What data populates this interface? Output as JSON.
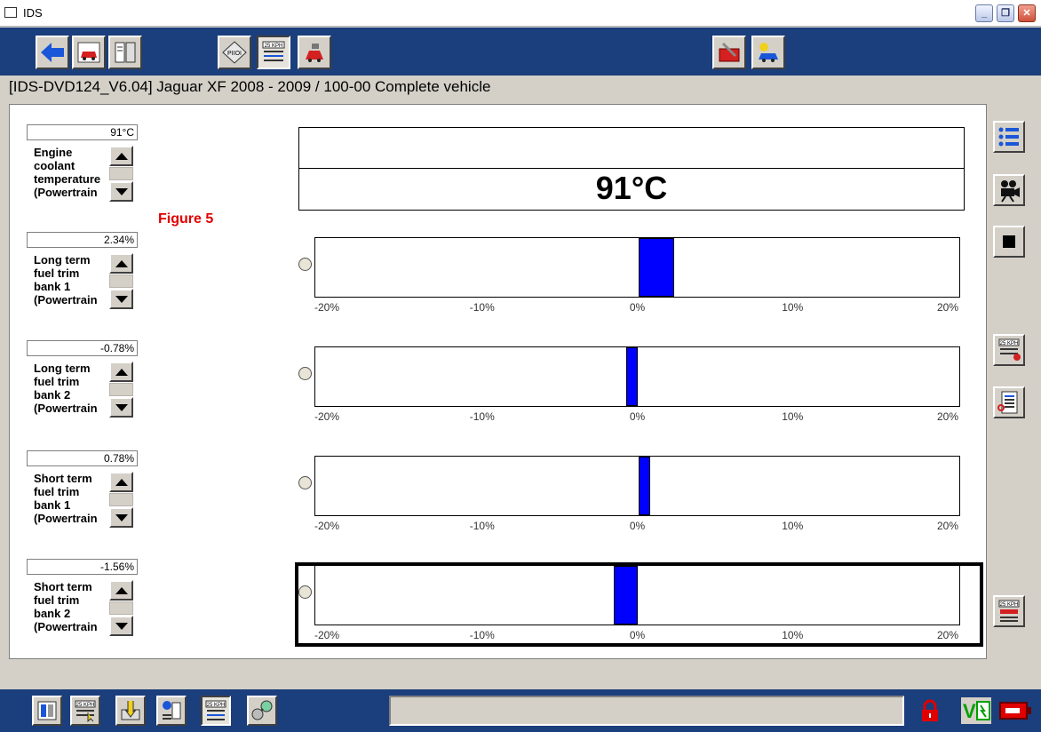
{
  "window": {
    "title": "IDS",
    "minimize_icon": "minimize-icon",
    "restore_icon": "restore-icon",
    "close_icon": "close-icon"
  },
  "toolbar": {
    "buttons": [
      {
        "name": "back-button",
        "icon": "back-arrow-icon"
      },
      {
        "name": "vehicle-session-button",
        "icon": "car-session-icon"
      },
      {
        "name": "toolbox-button",
        "icon": "toolbox-icon"
      },
      {
        "name": "pinpoint-test-button",
        "icon": "pinpoint-icon",
        "label": "PIIOI"
      },
      {
        "name": "datalogger-button",
        "icon": "datalogger-icon",
        "label": "25 KPH"
      },
      {
        "name": "workshop-tools-button",
        "icon": "workshop-tools-icon"
      },
      {
        "name": "settings-button",
        "icon": "tools-case-icon"
      },
      {
        "name": "vehicle-config-button",
        "icon": "vehicle-config-icon"
      }
    ]
  },
  "breadcrumb": "[IDS-DVD124_V6.04]  Jaguar XF 2008 - 2009 / 100-00 Complete vehicle",
  "figure_label": "Figure 5",
  "digital_display": {
    "value": "91°C"
  },
  "parameters": [
    {
      "value": "91°C",
      "name": "Engine\ncoolant\ntemperature\n(Powertrain"
    },
    {
      "value": "2.34%",
      "name": "Long term\nfuel trim\nbank 1\n(Powertrain"
    },
    {
      "value": "-0.78%",
      "name": "Long term\nfuel trim\nbank 2\n(Powertrain"
    },
    {
      "value": "0.78%",
      "name": "Short term\nfuel trim\nbank 1\n(Powertrain"
    },
    {
      "value": "-1.56%",
      "name": "Short term\nfuel trim\nbank 2\n(Powertrain"
    }
  ],
  "gauges": {
    "min": -20,
    "max": 20,
    "unit": "%",
    "ticks": [
      "-20%",
      "-10%",
      "0%",
      "10%",
      "20%"
    ],
    "bar_color": "#0000ff",
    "values": [
      2.34,
      -0.78,
      0.78,
      -1.56
    ],
    "selected_index": 3
  },
  "right_tools": [
    {
      "name": "parameter-list-button",
      "icon": "list-icon"
    },
    {
      "name": "record-button",
      "icon": "video-camera-icon"
    },
    {
      "name": "stop-button",
      "icon": "stop-icon"
    },
    {
      "name": "datalogger-recorded-button",
      "icon": "datalogger-record-icon",
      "label": "25 KPH"
    },
    {
      "name": "datalogger-list-button",
      "icon": "document-list-icon"
    },
    {
      "name": "datalogger-playback-button",
      "icon": "datalogger-playback-icon",
      "label": "25 KPH"
    }
  ],
  "bottom_tools": [
    {
      "name": "modules-button",
      "icon": "modules-icon"
    },
    {
      "name": "datalogger-select-button",
      "icon": "datalogger-select-icon",
      "label": "25 KPH"
    },
    {
      "name": "signal-generator-button",
      "icon": "signal-generator-icon"
    },
    {
      "name": "network-test-button",
      "icon": "network-icon"
    },
    {
      "name": "datalogger-active-button",
      "icon": "datalogger-active-icon",
      "label": "25 KPH"
    },
    {
      "name": "oscilloscope-button",
      "icon": "oscilloscope-icon"
    }
  ],
  "status_icons": {
    "lock": "lock-icon",
    "voltage": "voltage-icon",
    "battery": "battery-icon",
    "lock_color": "#e00000",
    "voltage_color": "#00a000"
  }
}
